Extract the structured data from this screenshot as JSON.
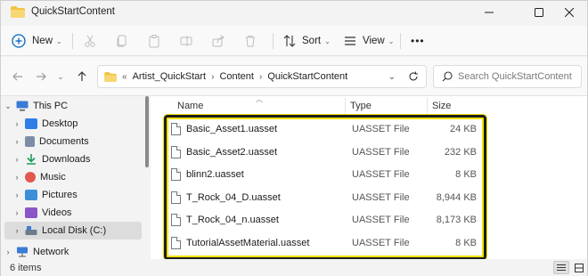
{
  "window": {
    "title": "QuickStartContent"
  },
  "toolbar": {
    "new_label": "New",
    "sort_label": "Sort",
    "view_label": "View",
    "more_label": "•••"
  },
  "address": {
    "overflow": "«",
    "crumbs": [
      "Artist_QuickStart",
      "Content",
      "QuickStartContent"
    ]
  },
  "search": {
    "placeholder": "Search QuickStartContent"
  },
  "sidebar": {
    "items": [
      {
        "label": "This PC",
        "icon": "pc-icon",
        "color": "#3a7bd5"
      },
      {
        "label": "Desktop",
        "icon": "desktop-icon",
        "color": "#2f7ee6"
      },
      {
        "label": "Documents",
        "icon": "documents-icon",
        "color": "#7b8ea6"
      },
      {
        "label": "Downloads",
        "icon": "downloads-icon",
        "color": "#1b9c5a"
      },
      {
        "label": "Music",
        "icon": "music-icon",
        "color": "#e2574c"
      },
      {
        "label": "Pictures",
        "icon": "pictures-icon",
        "color": "#3b8fd9"
      },
      {
        "label": "Videos",
        "icon": "videos-icon",
        "color": "#8a55c9"
      },
      {
        "label": "Local Disk (C:)",
        "icon": "drive-icon",
        "color": "#6b7a8c"
      },
      {
        "label": "Network",
        "icon": "network-icon",
        "color": "#3a7bd5"
      }
    ]
  },
  "columns": {
    "name": "Name",
    "type": "Type",
    "size": "Size"
  },
  "files": [
    {
      "name": "Basic_Asset1.uasset",
      "type": "UASSET File",
      "size": "24 KB"
    },
    {
      "name": "Basic_Asset2.uasset",
      "type": "UASSET File",
      "size": "232 KB"
    },
    {
      "name": "blinn2.uasset",
      "type": "UASSET File",
      "size": "8 KB"
    },
    {
      "name": "T_Rock_04_D.uasset",
      "type": "UASSET File",
      "size": "8,944 KB"
    },
    {
      "name": "T_Rock_04_n.uasset",
      "type": "UASSET File",
      "size": "8,173 KB"
    },
    {
      "name": "TutorialAssetMaterial.uasset",
      "type": "UASSET File",
      "size": "8 KB"
    }
  ],
  "status": {
    "count": "6 items"
  },
  "colors": {
    "highlight": "#f2e200",
    "accent": "#0067c0",
    "folder": "#f3c244"
  }
}
